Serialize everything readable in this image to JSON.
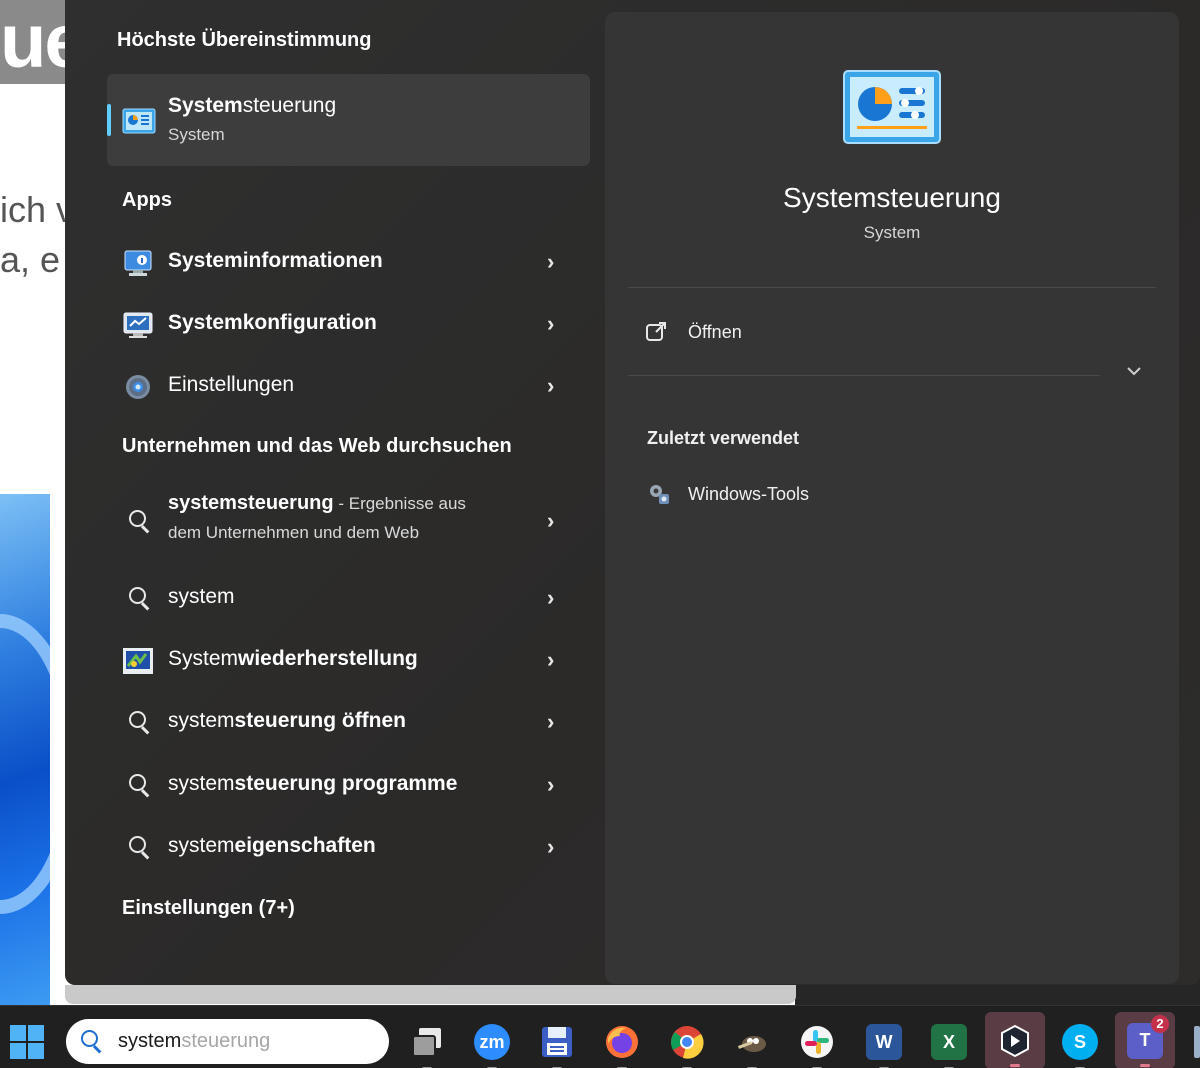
{
  "background_page": {
    "heading_fragment": "ue",
    "text_line_1": "ich v",
    "text_line_2": "a, e"
  },
  "start_menu": {
    "best_match": {
      "section_title": "Höchste Übereinstimmung",
      "item": {
        "title_bold": "System",
        "title_rest": "steuerung",
        "subtitle": "System",
        "icon": "control-panel-icon"
      }
    },
    "apps": {
      "section_title": "Apps",
      "items": [
        {
          "bold": "System",
          "rest": "informationen",
          "icon": "system-information-icon"
        },
        {
          "bold": "System",
          "rest": "konfiguration",
          "icon": "system-configuration-icon"
        },
        {
          "bold": "",
          "rest": "Einstellungen",
          "icon": "settings-gear-icon"
        }
      ]
    },
    "web": {
      "section_title": "Unternehmen und das Web durchsuchen",
      "first": {
        "term": "systemsteuerung",
        "suffix": " - Ergebnisse aus",
        "line2": "dem Unternehmen und dem Web"
      },
      "items": [
        {
          "normal": "system",
          "bold": "",
          "icon": "search-icon"
        },
        {
          "normal": "System",
          "bold": "wiederherstellung",
          "icon": "system-restore-icon"
        },
        {
          "normal": "system",
          "bold": "steuerung öffnen",
          "icon": "search-icon"
        },
        {
          "normal": "system",
          "bold": "steuerung programme",
          "icon": "search-icon"
        },
        {
          "normal": "system",
          "bold": "eigenschaften",
          "icon": "search-icon"
        }
      ]
    },
    "settings_section_title": "Einstellungen (7+)",
    "chevron": "›"
  },
  "details": {
    "title": "Systemsteuerung",
    "subtitle": "System",
    "open_label": "Öffnen",
    "recent_title": "Zuletzt verwendet",
    "recent_items": [
      {
        "label": "Windows-Tools",
        "icon": "windows-tools-icon"
      }
    ]
  },
  "taskbar": {
    "search": {
      "typed": "system",
      "suggestion": "steuerung"
    },
    "apps": [
      {
        "name": "task-view",
        "label": ""
      },
      {
        "name": "zoom",
        "label": "zm"
      },
      {
        "name": "save-disk",
        "label": ""
      },
      {
        "name": "firefox",
        "label": ""
      },
      {
        "name": "chrome",
        "label": ""
      },
      {
        "name": "gimp",
        "label": ""
      },
      {
        "name": "slack",
        "label": ""
      },
      {
        "name": "word",
        "label": "W"
      },
      {
        "name": "excel",
        "label": "X"
      },
      {
        "name": "app-shield",
        "label": ""
      },
      {
        "name": "skype",
        "label": "S"
      },
      {
        "name": "teams",
        "label": "T",
        "badge": "2"
      }
    ]
  },
  "colors": {
    "accent": "#60cdff",
    "menu_bg": "#2c2c2c",
    "details_bg": "#353535",
    "selected_bg": "#3d3d3d",
    "taskbar_bg": "#202020"
  }
}
